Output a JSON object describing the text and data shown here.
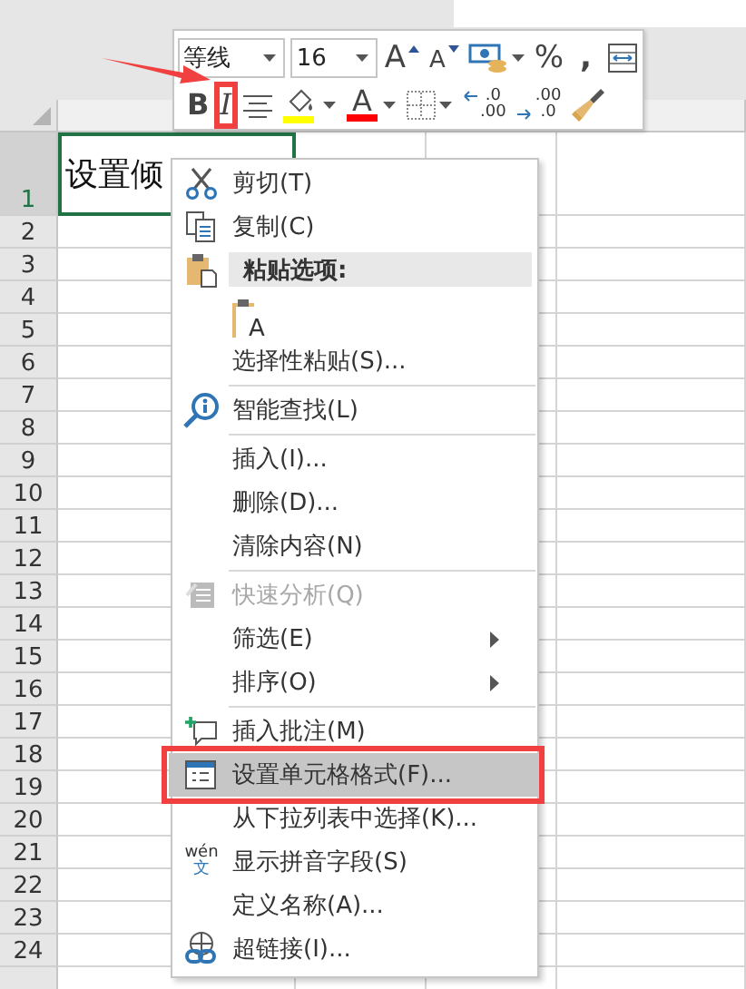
{
  "sheet": {
    "rows": [
      "1",
      "2",
      "3",
      "4",
      "5",
      "6",
      "7",
      "8",
      "9",
      "10",
      "11",
      "12",
      "13",
      "14",
      "15",
      "16",
      "17",
      "18",
      "19",
      "20",
      "21",
      "22",
      "23",
      "24"
    ],
    "cell_a1": "设置倾"
  },
  "toolbar": {
    "font_name": "等线",
    "font_size": "16",
    "row1": [
      {
        "kind": "grow-font",
        "label": "A"
      },
      {
        "kind": "shrink-font",
        "label": "A"
      },
      {
        "kind": "accounting"
      },
      {
        "kind": "percent",
        "label": "%"
      },
      {
        "kind": "comma",
        "label": ","
      },
      {
        "kind": "merge"
      }
    ],
    "row2": [
      {
        "kind": "bold",
        "label": "B",
        "annotated": false
      },
      {
        "kind": "italic",
        "label": "I",
        "annotated": true
      },
      {
        "kind": "align-center",
        "annotated": false
      },
      {
        "kind": "fill-color",
        "color": "#ffff00",
        "annotated": false
      },
      {
        "kind": "font-color",
        "label": "A",
        "color": "#ff0000",
        "annotated": false
      },
      {
        "kind": "borders",
        "annotated": false
      },
      {
        "kind": "increase-decimal",
        "labels": [
          ".0",
          ".00"
        ],
        "annotated": false
      },
      {
        "kind": "decrease-decimal",
        "labels": [
          ".00",
          ".0"
        ],
        "annotated": false
      },
      {
        "kind": "format-painter",
        "annotated": false
      }
    ]
  },
  "menu": {
    "items": [
      {
        "kind": "item",
        "label": "剪切(T)",
        "disabled": false,
        "submenu": false,
        "selected": false,
        "annotated": false
      },
      {
        "kind": "item",
        "label": "复制(C)",
        "disabled": false,
        "submenu": false,
        "selected": false,
        "annotated": false
      },
      {
        "kind": "header",
        "label": "粘贴选项:"
      },
      {
        "kind": "paste-options",
        "options": [
          {
            "label": "A"
          }
        ]
      },
      {
        "kind": "item",
        "label": "选择性粘贴(S)...",
        "disabled": false,
        "submenu": false,
        "selected": false,
        "annotated": false
      },
      {
        "kind": "separator"
      },
      {
        "kind": "item",
        "label": "智能查找(L)",
        "disabled": false,
        "submenu": false,
        "selected": false,
        "annotated": false
      },
      {
        "kind": "separator"
      },
      {
        "kind": "item",
        "label": "插入(I)...",
        "disabled": false,
        "submenu": false,
        "selected": false,
        "annotated": false
      },
      {
        "kind": "item",
        "label": "删除(D)...",
        "disabled": false,
        "submenu": false,
        "selected": false,
        "annotated": false
      },
      {
        "kind": "item",
        "label": "清除内容(N)",
        "disabled": false,
        "submenu": false,
        "selected": false,
        "annotated": false
      },
      {
        "kind": "separator"
      },
      {
        "kind": "item",
        "label": "快速分析(Q)",
        "disabled": true,
        "submenu": false,
        "selected": false,
        "annotated": false
      },
      {
        "kind": "item",
        "label": "筛选(E)",
        "disabled": false,
        "submenu": true,
        "selected": false,
        "annotated": false
      },
      {
        "kind": "item",
        "label": "排序(O)",
        "disabled": false,
        "submenu": true,
        "selected": false,
        "annotated": false
      },
      {
        "kind": "separator"
      },
      {
        "kind": "item",
        "label": "插入批注(M)",
        "disabled": false,
        "submenu": false,
        "selected": false,
        "annotated": false
      },
      {
        "kind": "item",
        "label": "设置单元格格式(F)...",
        "disabled": false,
        "submenu": false,
        "selected": true,
        "annotated": true
      },
      {
        "kind": "item",
        "label": "从下拉列表中选择(K)...",
        "disabled": false,
        "submenu": false,
        "selected": false,
        "annotated": false
      },
      {
        "kind": "item",
        "icon_text": [
          "wén",
          "文"
        ],
        "label": "显示拼音字段(S)",
        "disabled": false,
        "submenu": false,
        "selected": false,
        "annotated": false
      },
      {
        "kind": "item",
        "label": "定义名称(A)...",
        "disabled": false,
        "submenu": false,
        "selected": false,
        "annotated": false
      },
      {
        "kind": "item",
        "label": "超链接(I)...",
        "disabled": false,
        "submenu": false,
        "selected": false,
        "annotated": false
      }
    ]
  },
  "annotations": {
    "arrow": true
  }
}
